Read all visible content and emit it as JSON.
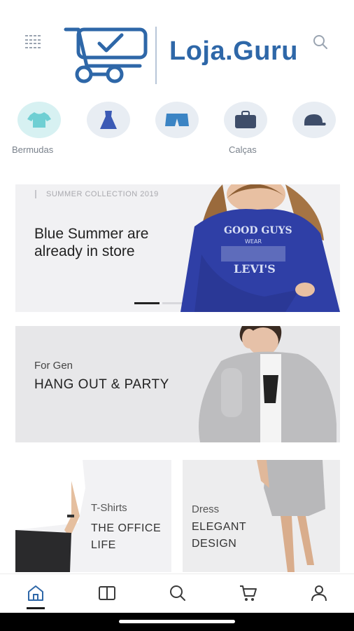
{
  "header": {
    "brand": "Loja.Guru",
    "menu_icon": "grid-menu-icon",
    "search_icon": "search-icon",
    "brand_color": "#2e67a8"
  },
  "categories": [
    {
      "label": "Bermudas",
      "icon": "shirt-icon",
      "active": true
    },
    {
      "label": "",
      "icon": "dress-icon",
      "active": false
    },
    {
      "label": "",
      "icon": "shorts-icon",
      "active": false
    },
    {
      "label": "Calças",
      "icon": "bag-icon",
      "active": false
    },
    {
      "label": "",
      "icon": "cap-icon",
      "active": false
    }
  ],
  "banners": {
    "summer": {
      "eyebrow": "SUMMER COLLECTION 2019",
      "title": "Blue Summer are already in store"
    },
    "party": {
      "subtitle": "For Gen",
      "title": "HANG OUT & PARTY"
    },
    "tshirts": {
      "subtitle": "T-Shirts",
      "title": "THE OFFICE LIFE"
    },
    "dress": {
      "subtitle": "Dress",
      "title": "ELEGANT DESIGN"
    }
  },
  "bottom_nav": [
    {
      "icon": "home-icon",
      "active": true
    },
    {
      "icon": "catalog-icon",
      "active": false
    },
    {
      "icon": "search-icon",
      "active": false
    },
    {
      "icon": "cart-icon",
      "active": false
    },
    {
      "icon": "profile-icon",
      "active": false
    }
  ],
  "colors": {
    "accent": "#2e67a8",
    "active_category_bg": "#d7f1f2",
    "category_bg": "#e8edf3",
    "sweater_blue": "#2f3fa6"
  }
}
